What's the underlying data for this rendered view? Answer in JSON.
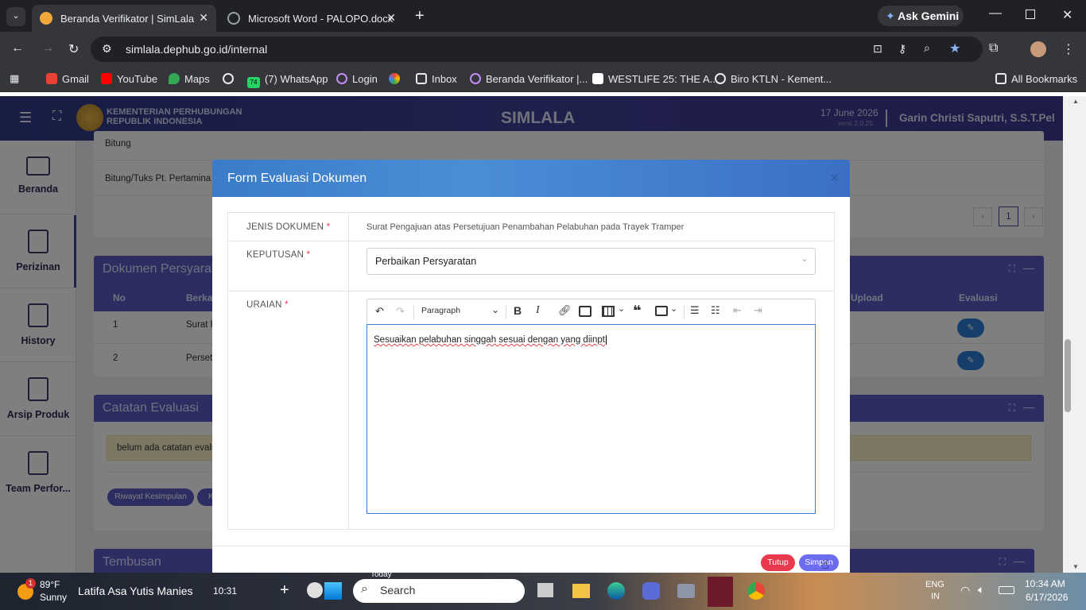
{
  "browser": {
    "tabs": [
      {
        "title": "Beranda Verifikator | SimLala",
        "active": true
      },
      {
        "title": "Microsoft Word - PALOPO.docx",
        "active": false
      }
    ],
    "ask_gemini": "Ask Gemini",
    "url": "simlala.dephub.go.id/internal",
    "bookmarks": [
      "Gmail",
      "YouTube",
      "Maps",
      "(7) WhatsApp",
      "Login",
      "Inbox",
      "Beranda Verifikator |...",
      "WESTLIFE 25: THE A...",
      "Biro KTLN - Kement..."
    ],
    "whatsapp_badge": "74",
    "all_bookmarks": "All Bookmarks"
  },
  "app": {
    "org_line1": "KEMENTERIAN PERHUBUNGAN",
    "org_line2": "REPUBLIK INDONESIA",
    "title": "SIMLALA",
    "date": "17 June 2026",
    "version": "versi 2.0.25",
    "user": "Garin Christi Saputri, S.S.T.Pel",
    "sidebar": [
      "Beranda",
      "Perizinan",
      "History",
      "Arsip Produk",
      "Team Perfor..."
    ]
  },
  "background": {
    "rows": [
      "Bitung",
      "Bitung/Tuks Pt. Pertamina"
    ],
    "page_number": "1",
    "dok_card_title": "Dokumen Persyarat",
    "dok_headers": {
      "no": "No",
      "berkas": "Berkas",
      "upload": "Upload",
      "evaluasi": "Evaluasi"
    },
    "dok_rows": [
      {
        "no": "1",
        "berkas": "Surat P"
      },
      {
        "no": "2",
        "berkas": "Persetu"
      }
    ],
    "catatan_title": "Catatan Evaluasi",
    "catatan_empty": "belum ada catatan evalu",
    "riwayat_button": "Riwayat Kesimpulan",
    "riwayat_button2": "K",
    "tembusan_title": "Tembusan"
  },
  "modal": {
    "title": "Form Evaluasi Dokumen",
    "close": "×",
    "jenis_label": "JENIS DOKUMEN",
    "jenis_value": "Surat Pengajuan atas Persetujuan Penambahan Pelabuhan pada Trayek Tramper",
    "keputusan_label": "KEPUTUSAN",
    "keputusan_value": "Perbaikan Persyaratan",
    "uraian_label": "URAIAN",
    "required_mark": "*",
    "editor_format": "Paragraph",
    "uraian_text": "Sesuaikan pelabuhan singgah sesuai dengan yang diinpt",
    "tutup": "Tutup",
    "simpan": "Simpan"
  },
  "taskbar": {
    "weather_temp": "89°F",
    "weather_cond": "Sunny",
    "notif_badge": "1",
    "media_title": "Latifa Asa Yutis Manies",
    "media_time": "10:31",
    "today": "Today",
    "search": "Search",
    "lang1": "ENG",
    "lang2": "IN",
    "time": "10:34 AM",
    "date": "6/17/2026"
  },
  "colors": {
    "accent": "#5a5bc4",
    "header": "#3a7cc7",
    "tutup": "#e8394e",
    "simpan": "#6c6cf0"
  }
}
